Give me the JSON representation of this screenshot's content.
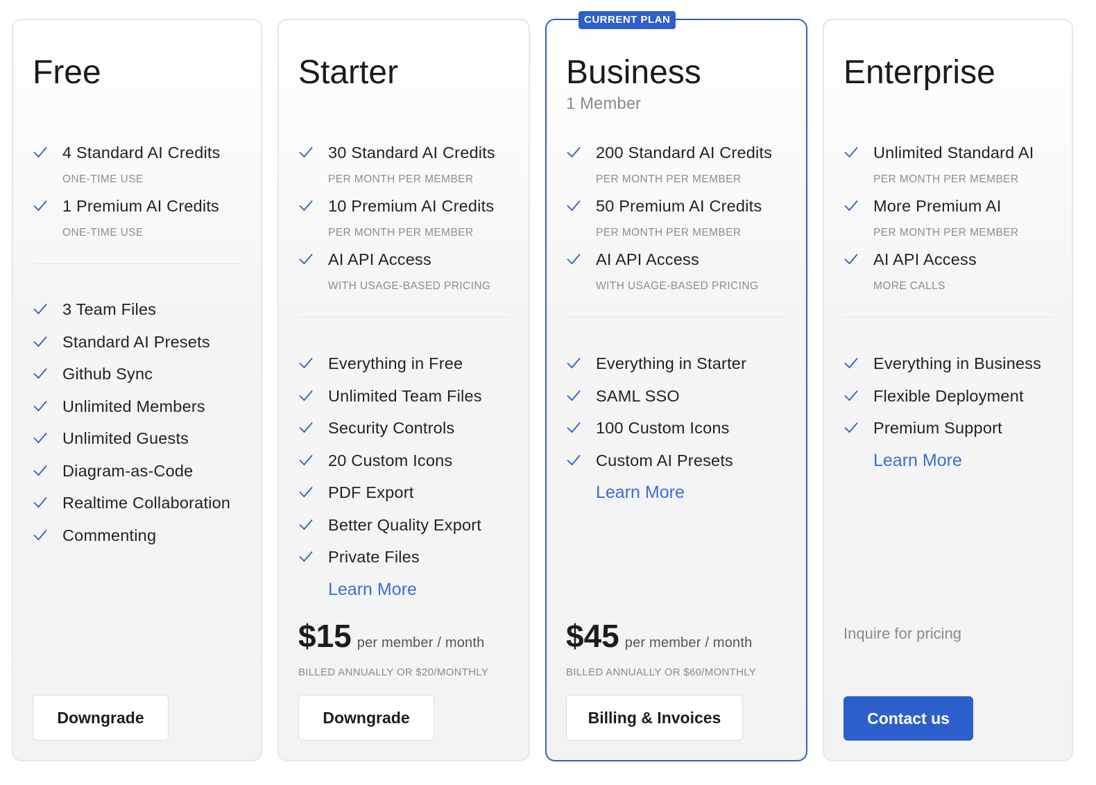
{
  "plans": [
    {
      "name": "Free",
      "credits": [
        {
          "label": "4 Standard AI Credits",
          "note": "ONE-TIME USE"
        },
        {
          "label": "1 Premium AI Credits",
          "note": "ONE-TIME USE"
        }
      ],
      "features": [
        "3 Team Files",
        "Standard AI Presets",
        "Github Sync",
        "Unlimited Members",
        "Unlimited Guests",
        "Diagram-as-Code",
        "Realtime Collaboration",
        "Commenting"
      ],
      "button": "Downgrade"
    },
    {
      "name": "Starter",
      "credits": [
        {
          "label": "30 Standard AI Credits",
          "note": "PER MONTH PER MEMBER"
        },
        {
          "label": "10 Premium AI Credits",
          "note": "PER MONTH PER MEMBER"
        },
        {
          "label": "AI API Access",
          "note": "WITH USAGE-BASED PRICING"
        }
      ],
      "features": [
        "Everything in Free",
        "Unlimited Team Files",
        "Security Controls",
        "20 Custom Icons",
        "PDF Export",
        "Better Quality Export",
        "Private Files"
      ],
      "learn_more": "Learn More",
      "price": "$15",
      "price_unit": "per member / month",
      "billed": "BILLED ANNUALLY OR $20/MONTHLY",
      "button": "Downgrade"
    },
    {
      "badge": "CURRENT PLAN",
      "name": "Business",
      "subtitle": "1 Member",
      "credits": [
        {
          "label": "200 Standard AI Credits",
          "note": "PER MONTH PER MEMBER"
        },
        {
          "label": "50 Premium AI Credits",
          "note": "PER MONTH PER MEMBER"
        },
        {
          "label": "AI API Access",
          "note": "WITH USAGE-BASED PRICING"
        }
      ],
      "features": [
        "Everything in Starter",
        "SAML SSO",
        "100 Custom Icons",
        "Custom AI Presets"
      ],
      "learn_more": "Learn More",
      "price": "$45",
      "price_unit": "per member / month",
      "billed": "BILLED ANNUALLY OR $60/MONTHLY",
      "button": "Billing & Invoices"
    },
    {
      "name": "Enterprise",
      "credits": [
        {
          "label": "Unlimited Standard AI",
          "note": "PER MONTH PER MEMBER"
        },
        {
          "label": "More Premium AI",
          "note": "PER MONTH PER MEMBER"
        },
        {
          "label": "AI API Access",
          "note": "MORE CALLS"
        }
      ],
      "features": [
        "Everything in Business",
        "Flexible Deployment",
        "Premium Support"
      ],
      "learn_more": "Learn More",
      "pricing_text": "Inquire for pricing",
      "button": "Contact us"
    }
  ],
  "colors": {
    "accent": "#2f5fc8",
    "check": "#2f5fc8",
    "link": "#3a6fd8",
    "muted": "#8a8a8a"
  },
  "icons": {
    "check": "check-icon"
  }
}
